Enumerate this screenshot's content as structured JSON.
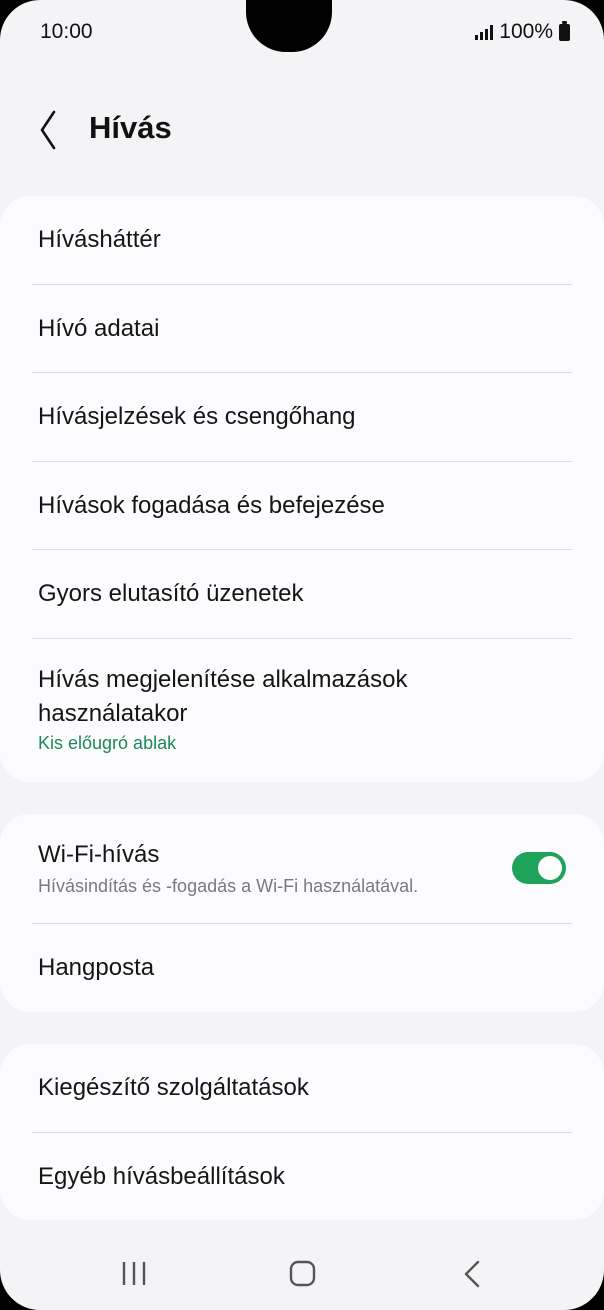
{
  "status_bar": {
    "time": "10:00",
    "battery": "100%"
  },
  "header": {
    "title": "Hívás"
  },
  "card1": {
    "items": [
      {
        "label": "Hívásháttér"
      },
      {
        "label": "Hívó adatai"
      },
      {
        "label": "Hívásjelzések és csengőhang"
      },
      {
        "label": "Hívások fogadása és befejezése"
      },
      {
        "label": "Gyors elutasító üzenetek"
      },
      {
        "label_line1": "Hívás megjelenítése alkalmazások",
        "label_line2": "használatakor",
        "sub": "Kis előugró ablak"
      }
    ]
  },
  "card2": {
    "wifi": {
      "label": "Wi-Fi-hívás",
      "sub": "Hívásindítás és -fogadás a Wi-Fi használatával.",
      "enabled": true
    },
    "voicemail": {
      "label": "Hangposta"
    }
  },
  "card3": {
    "items": [
      {
        "label": "Kiegészítő szolgáltatások"
      },
      {
        "label": "Egyéb hívásbeállítások"
      }
    ]
  },
  "colors": {
    "accent_green": "#1fa35a",
    "subtext_green": "#1b8a55",
    "background": "#f4f4f6",
    "card": "#fcfcfe"
  },
  "icons": {
    "back": "chevron-left-icon",
    "signal": "signal-icon",
    "battery": "battery-icon",
    "nav_recents": "recents-icon",
    "nav_home": "home-icon",
    "nav_back": "back-icon"
  }
}
